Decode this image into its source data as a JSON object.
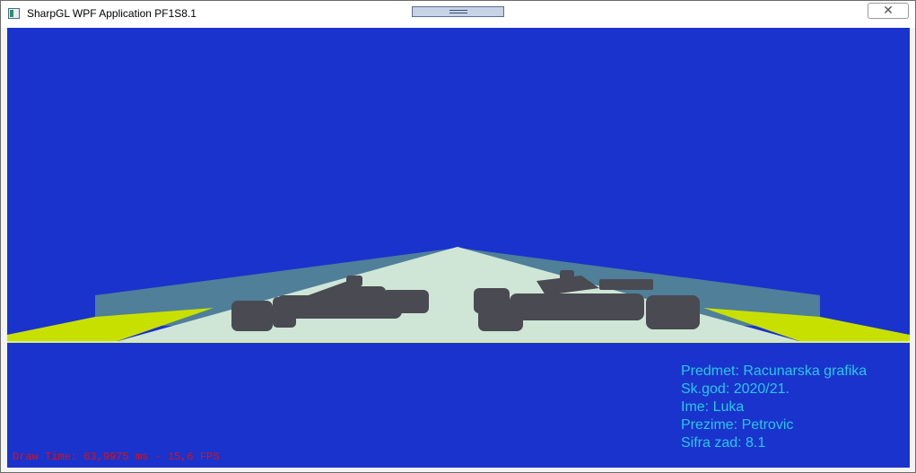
{
  "window": {
    "title": "SharpGL WPF Application PF1S8.1",
    "close_glyph": "✕",
    "icons": {
      "app": "window-app-icon",
      "restore": "restore-icon",
      "close": "close-icon"
    }
  },
  "scene": {
    "background_color": "#1a33cc",
    "track_color": "#cfe6d6",
    "wall_color": "#4f7f99",
    "curb_color": "#c8e000",
    "car_color": "#4a4a52"
  },
  "overlay": {
    "info_lines": [
      "Predmet: Racunarska grafika",
      "Sk.god: 2020/21.",
      "Ime: Luka",
      "Prezime: Petrovic",
      "Sifra zad: 8.1"
    ],
    "info_color": "#28c8e6",
    "draw_time": "Draw Time: 63,9975 ms - 15,6 FPS",
    "draw_time_color": "#e01010"
  }
}
